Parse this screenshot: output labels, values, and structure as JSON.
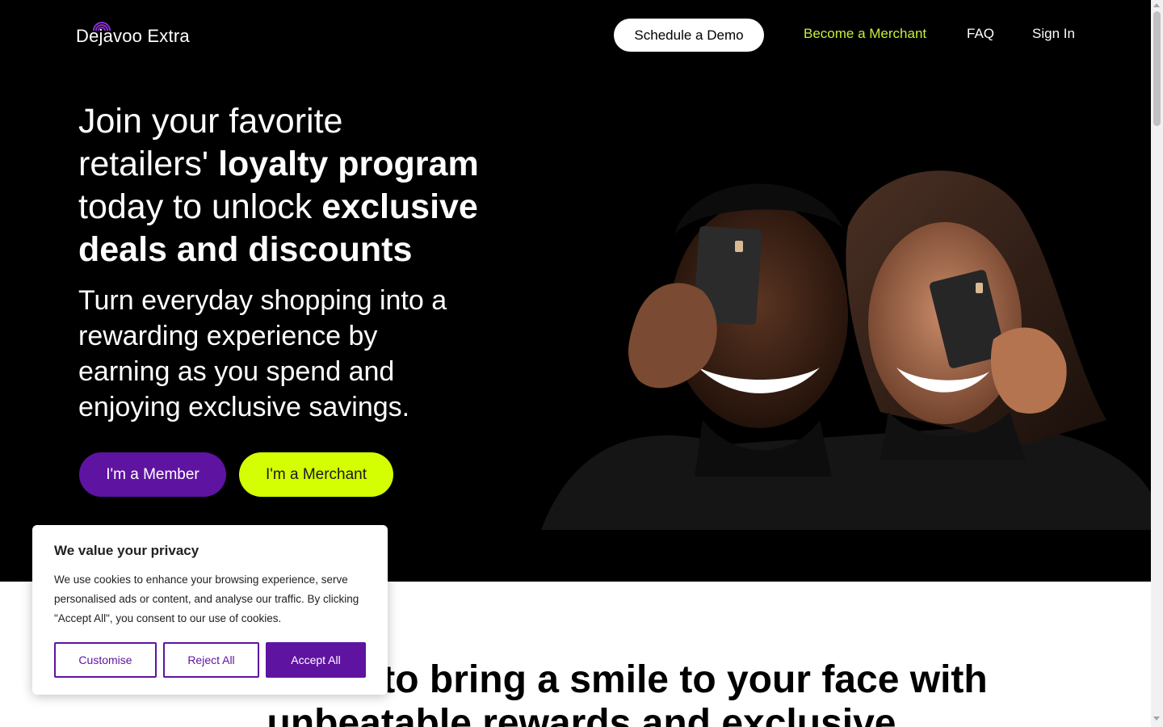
{
  "nav": {
    "logo_text": "Dejavoo Extra",
    "demo_label": "Schedule a Demo",
    "merchant_label": "Become a Merchant",
    "faq_label": "FAQ",
    "signin_label": "Sign In"
  },
  "hero": {
    "headline_1": "Join your favorite retailers' ",
    "headline_2": "loyalty program",
    "headline_3": " today to unlock ",
    "headline_4": "exclusive deals and discounts",
    "subhead": "Turn everyday shopping into a rewarding experience by earning as you spend and enjoying exclusive savings.",
    "member_button": "I'm a Member",
    "merchant_button": "I'm a Merchant"
  },
  "section": {
    "heading": "We're here to bring a smile to your face with unbeatable rewards and exclusive"
  },
  "cookie": {
    "title": "We value your privacy",
    "text": "We use cookies to enhance your browsing experience, serve personalised ads or content, and analyse our traffic. By clicking \"Accept All\", you consent to our use of cookies.",
    "customise": "Customise",
    "reject": "Reject All",
    "accept": "Accept All"
  },
  "colors": {
    "brand_purple": "#5f13a1",
    "brand_lime": "#d4fe02",
    "nav_lime": "#c3ef3c",
    "hero_bg": "#000000"
  },
  "icons": {
    "logo": "dejavoo-arc-logo",
    "photo": "couple-holding-cards-photo"
  }
}
